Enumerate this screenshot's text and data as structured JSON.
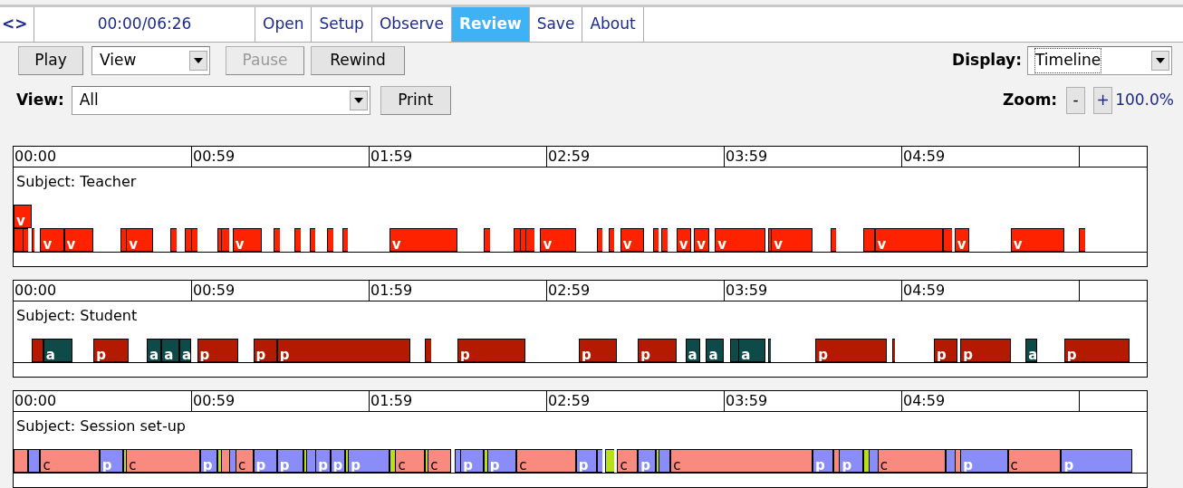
{
  "nav": {
    "toggle": "<>",
    "time": "00:00/06:26"
  },
  "tabs": [
    {
      "label": "Open",
      "selected": false
    },
    {
      "label": "Setup",
      "selected": false
    },
    {
      "label": "Observe",
      "selected": false
    },
    {
      "label": "Review",
      "selected": true
    },
    {
      "label": "Save",
      "selected": false
    },
    {
      "label": "About",
      "selected": false
    }
  ],
  "controls": {
    "play": "Play",
    "mode_select": "View",
    "pause": {
      "label": "Pause",
      "disabled": true
    },
    "rewind": "Rewind",
    "view_label": "View:",
    "view_select": "All",
    "print": "Print",
    "display_label": "Display:",
    "display_select": "Timeline",
    "zoom_label": "Zoom:",
    "zoom_out": "-",
    "zoom_in": "+",
    "zoom_value": "100.0%"
  },
  "subjects": [
    {
      "ticks": [
        "00:00",
        "00:59",
        "01:59",
        "02:59",
        "03:59",
        "04:59"
      ],
      "title": "Subject: Teacher",
      "rows": [
        [
          {
            "label": "v",
            "color": "#ff2200"
          }
        ],
        [
          {
            "color": "#ff2200"
          },
          {
            "color": "#ff2200"
          },
          {
            "color": "#ff2200"
          },
          {
            "label": "v",
            "color": "#ff2200"
          },
          {
            "label": "v",
            "color": "#ff2200"
          },
          {
            "color": "#ff2200"
          },
          {
            "label": "v",
            "color": "#ff2200"
          },
          {
            "color": "#ff2200"
          },
          {
            "color": "#ff2200"
          },
          {
            "color": "#ff2200"
          },
          {
            "color": "#ff2200"
          },
          {
            "color": "#ff2200"
          },
          {
            "label": "v",
            "color": "#ff2200"
          },
          {
            "color": "#ff2200"
          },
          {
            "color": "#ff2200"
          },
          {
            "color": "#ff2200"
          },
          {
            "color": "#ff2200"
          },
          {
            "color": "#ff2200"
          },
          {
            "label": "v",
            "color": "#ff2200"
          },
          {
            "color": "#ff2200"
          },
          {
            "color": "#ff2200"
          },
          {
            "color": "#ff2200"
          },
          {
            "color": "#ff2200"
          },
          {
            "label": "v",
            "color": "#ff2200"
          },
          {
            "color": "#ff2200"
          },
          {
            "color": "#ff2200"
          },
          {
            "label": "v",
            "color": "#ff2200"
          },
          {
            "color": "#ff2200"
          },
          {
            "color": "#ff2200"
          },
          {
            "label": "v",
            "color": "#ff2200"
          },
          {
            "label": "v",
            "color": "#ff2200"
          },
          {
            "label": "v",
            "color": "#ff2200"
          },
          {
            "color": "#ff2200"
          },
          {
            "label": "v",
            "color": "#ff2200"
          },
          {
            "color": "#ff2200"
          },
          {
            "color": "#ff2200"
          },
          {
            "label": "v",
            "color": "#ff2200"
          },
          {
            "color": "#ff2200"
          },
          {
            "label": "v",
            "color": "#ff2200"
          },
          {
            "label": "v",
            "color": "#ff2200"
          },
          {
            "color": "#ff2200"
          }
        ]
      ]
    },
    {
      "ticks": [
        "00:00",
        "00:59",
        "01:59",
        "02:59",
        "03:59",
        "04:59"
      ],
      "title": "Subject: Student",
      "rows": [
        [
          {
            "color": "#b31a00"
          },
          {
            "label": "a",
            "color": "#0d4a48"
          },
          {
            "label": "p",
            "color": "#b31a00"
          },
          {
            "label": "a",
            "color": "#0d4a48"
          },
          {
            "label": "a",
            "color": "#0d4a48"
          },
          {
            "label": "a",
            "color": "#0d4a48"
          },
          {
            "label": "p",
            "color": "#b31a00"
          },
          {
            "label": "p",
            "color": "#b31a00"
          },
          {
            "label": "p",
            "color": "#b31a00"
          },
          {
            "color": "#b31a00"
          },
          {
            "label": "p",
            "color": "#b31a00"
          },
          {
            "label": "p",
            "color": "#b31a00"
          },
          {
            "label": "p",
            "color": "#b31a00"
          },
          {
            "label": "a",
            "color": "#0d4a48"
          },
          {
            "label": "a",
            "color": "#0d4a48"
          },
          {
            "color": "#0d4a48"
          },
          {
            "label": "a",
            "color": "#0d4a48"
          },
          {
            "color": "#0d4a48"
          },
          {
            "label": "p",
            "color": "#b31a00"
          },
          {
            "color": "#b31a00"
          },
          {
            "label": "p",
            "color": "#b31a00"
          },
          {
            "label": "p",
            "color": "#b31a00"
          },
          {
            "label": "a",
            "color": "#0d4a48"
          },
          {
            "label": "p",
            "color": "#b31a00"
          }
        ]
      ]
    },
    {
      "ticks": [
        "00:00",
        "00:59",
        "01:59",
        "02:59",
        "03:59",
        "04:59"
      ],
      "title": "Subject: Session set-up",
      "rows": [
        [
          {
            "color": "#f88a80"
          },
          {
            "color": "#8a8cf8"
          },
          {
            "label": "c",
            "color": "#f88a80"
          },
          {
            "label": "p",
            "color": "#8a8cf8"
          },
          {
            "color": "#b8e01a"
          },
          {
            "label": "c",
            "color": "#f88a80"
          },
          {
            "label": "p",
            "color": "#8a8cf8"
          },
          {
            "color": "#b8e01a"
          },
          {
            "color": "#f88a80"
          },
          {
            "color": "#8a8cf8"
          },
          {
            "label": "c",
            "color": "#f88a80"
          },
          {
            "label": "p",
            "color": "#8a8cf8"
          },
          {
            "label": "p",
            "color": "#8a8cf8"
          },
          {
            "color": "#b8e01a"
          },
          {
            "color": "#8a8cf8"
          },
          {
            "label": "p",
            "color": "#8a8cf8"
          },
          {
            "label": "p",
            "color": "#8a8cf8"
          },
          {
            "color": "#b8e01a"
          },
          {
            "label": "p",
            "color": "#8a8cf8"
          },
          {
            "color": "#b8e01a"
          },
          {
            "label": "c",
            "color": "#f88a80"
          },
          {
            "color": "#b8e01a"
          },
          {
            "label": "c",
            "color": "#f88a80"
          },
          {
            "color": "#8a8cf8"
          },
          {
            "label": "p",
            "color": "#8a8cf8"
          },
          {
            "color": "#b8e01a"
          },
          {
            "label": "p",
            "color": "#8a8cf8"
          },
          {
            "label": "c",
            "color": "#f88a80"
          },
          {
            "label": "p",
            "color": "#8a8cf8"
          },
          {
            "color": "#8a8cf8"
          },
          {
            "color": "#b8e01a"
          },
          {
            "label": "c",
            "color": "#f88a80"
          },
          {
            "label": "p",
            "color": "#8a8cf8"
          },
          {
            "color": "#b8e01a"
          },
          {
            "color": "#8a8cf8"
          },
          {
            "label": "c",
            "color": "#f88a80"
          },
          {
            "label": "p",
            "color": "#8a8cf8"
          },
          {
            "color": "#f88a80"
          },
          {
            "label": "p",
            "color": "#8a8cf8"
          },
          {
            "color": "#b8e01a"
          },
          {
            "color": "#8a8cf8"
          },
          {
            "label": "c",
            "color": "#f88a80"
          },
          {
            "color": "#8a8cf8"
          },
          {
            "color": "#f88a80"
          },
          {
            "label": "p",
            "color": "#8a8cf8"
          },
          {
            "label": "c",
            "color": "#f88a80"
          },
          {
            "label": "p",
            "color": "#8a8cf8"
          }
        ]
      ]
    }
  ]
}
